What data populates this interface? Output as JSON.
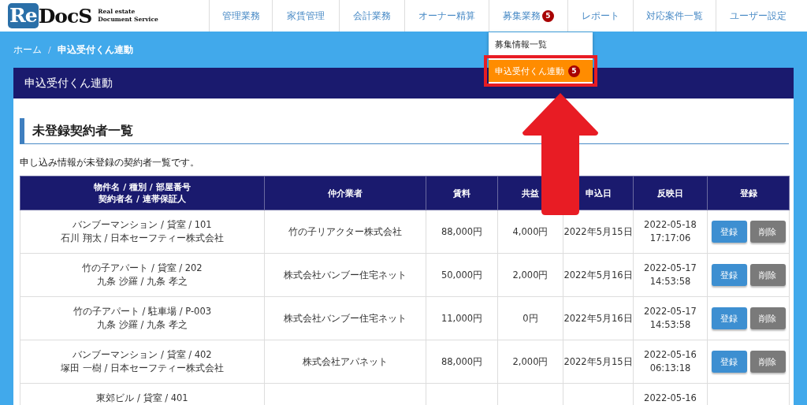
{
  "logo": {
    "mark": "Re",
    "name": "DocS",
    "tagline_1": "Real estate",
    "tagline_2": "Document Service"
  },
  "nav": [
    {
      "label": "管理業務"
    },
    {
      "label": "家賃管理"
    },
    {
      "label": "会計業務"
    },
    {
      "label": "オーナー精算"
    },
    {
      "label": "募集業務",
      "badge": "5",
      "menu": [
        {
          "label": "募集情報一覧",
          "selected": false
        },
        {
          "label": "申込受付くん連動",
          "badge": "5",
          "selected": true
        }
      ]
    },
    {
      "label": "レポート"
    },
    {
      "label": "対応案件一覧"
    },
    {
      "label": "ユーザー設定"
    }
  ],
  "breadcrumb": [
    {
      "label": "ホーム"
    },
    {
      "label": "申込受付くん連動"
    }
  ],
  "breadcrumb_separator": "/",
  "panel_title": "申込受付くん連動",
  "section_title": "未登録契約者一覧",
  "description": "申し込み情報が未登録の契約者一覧です。",
  "table": {
    "columns": [
      [
        "物件名 / 種別 / 部屋番号",
        "契約者名 / 連帯保証人"
      ],
      "仲介業者",
      "賃料",
      "共益",
      "申込日",
      "反映日",
      "登録"
    ],
    "rows": [
      {
        "property": "バンブーマンション / 貸室 / 101",
        "tenant": "石川 翔太 / 日本セーフティー株式会社",
        "agent": "竹の子リアクター株式会社",
        "rent": "88,000円",
        "common_fee": "4,000円",
        "applied": "2022年5月15日",
        "reflected_date": "2022-05-18",
        "reflected_time": "17:17:06",
        "actions": [
          {
            "label": "登録",
            "kind": "register"
          },
          {
            "label": "削除",
            "kind": "delete"
          }
        ]
      },
      {
        "property": "竹の子アパート / 貸室 / 202",
        "tenant": "九条 沙羅 / 九条 孝之",
        "agent": "株式会社バンブー住宅ネット",
        "rent": "50,000円",
        "common_fee": "2,000円",
        "applied": "2022年5月16日",
        "reflected_date": "2022-05-17",
        "reflected_time": "14:53:58",
        "actions": [
          {
            "label": "登録",
            "kind": "register"
          },
          {
            "label": "削除",
            "kind": "delete"
          }
        ]
      },
      {
        "property": "竹の子アパート / 駐車場 / P-003",
        "tenant": "九条 沙羅 / 九条 孝之",
        "agent": "株式会社バンブー住宅ネット",
        "rent": "11,000円",
        "common_fee": "0円",
        "applied": "2022年5月16日",
        "reflected_date": "2022-05-17",
        "reflected_time": "14:53:58",
        "actions": [
          {
            "label": "登録",
            "kind": "register"
          },
          {
            "label": "削除",
            "kind": "delete"
          }
        ]
      },
      {
        "property": "バンブーマンション / 貸室 / 402",
        "tenant": "塚田 一樹 / 日本セーフティー株式会社",
        "agent": "株式会社アパネット",
        "rent": "88,000円",
        "common_fee": "2,000円",
        "applied": "2022年5月15日",
        "reflected_date": "2022-05-16",
        "reflected_time": "06:13:18",
        "actions": [
          {
            "label": "登録",
            "kind": "register"
          },
          {
            "label": "削除",
            "kind": "delete"
          }
        ]
      },
      {
        "property": "東郊ビル / 貸室 / 401",
        "reflected_date": "2022-05-16"
      }
    ]
  }
}
